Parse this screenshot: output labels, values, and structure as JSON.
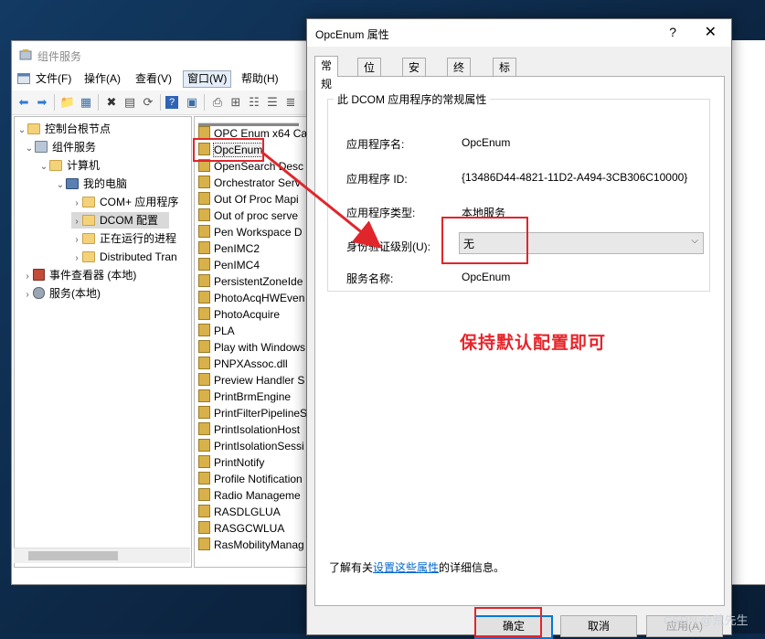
{
  "main_window": {
    "title": "组件服务",
    "menu": [
      "文件(F)",
      "操作(A)",
      "查看(V)",
      "窗口(W)",
      "帮助(H)"
    ],
    "active_menu": "窗口(W)"
  },
  "tree": {
    "items": [
      {
        "label": "控制台根节点"
      },
      {
        "label": "组件服务"
      },
      {
        "label": "计算机"
      },
      {
        "label": "我的电脑"
      },
      {
        "label": "COM+ 应用程序"
      },
      {
        "label": "DCOM 配置"
      },
      {
        "label": "正在运行的进程"
      },
      {
        "label": "Distributed Tran"
      },
      {
        "label": "事件查看器 (本地)"
      },
      {
        "label": "服务(本地)"
      }
    ]
  },
  "list": {
    "items": [
      "OPC Enum x64 Ca",
      "OpcEnum",
      "OpenSearch Desc",
      "Orchestrator Serv",
      "Out Of Proc Mapi",
      "Out of proc serve",
      "Pen Workspace D",
      "PenIMC2",
      "PenIMC4",
      "PersistentZoneIde",
      "PhotoAcqHWEven",
      "PhotoAcquire",
      "PLA",
      "Play with Windows",
      "PNPXAssoc.dll",
      "Preview Handler S",
      "PrintBrmEngine",
      "PrintFilterPipelineS",
      "PrintIsolationHost",
      "PrintIsolationSessi",
      "PrintNotify",
      "Profile Notification",
      "Radio Manageme",
      "RASDLGLUA",
      "RASGCWLUA",
      "RasMobilityManag"
    ]
  },
  "dialog": {
    "title": "OpcEnum 属性",
    "help": "?",
    "close": "✕",
    "tabs": [
      "常规",
      "位置",
      "安全",
      "终结点",
      "标识"
    ],
    "group_title": "此 DCOM 应用程序的常规属性",
    "fields": {
      "app_name_label": "应用程序名:",
      "app_name": "OpcEnum",
      "app_id_label": "应用程序 ID:",
      "app_id": "{13486D44-4821-11D2-A494-3CB306C10000}",
      "app_type_label": "应用程序类型:",
      "app_type": "本地服务",
      "auth_label": "身份验证级别(U):",
      "auth_value": "无",
      "service_label": "服务名称:",
      "service_name": "OpcEnum"
    },
    "info_prefix": "了解有关",
    "info_link": "设置这些属性",
    "info_suffix": "的详细信息。",
    "buttons": {
      "ok": "确定",
      "cancel": "取消",
      "apply": "应用(A)"
    }
  },
  "annotation": "保持默认配置即可",
  "watermark": "CSDN @荒先生",
  "colors": {
    "annotation_red": "#e0262b",
    "accent": "#0078d7",
    "link": "#0066cc"
  }
}
